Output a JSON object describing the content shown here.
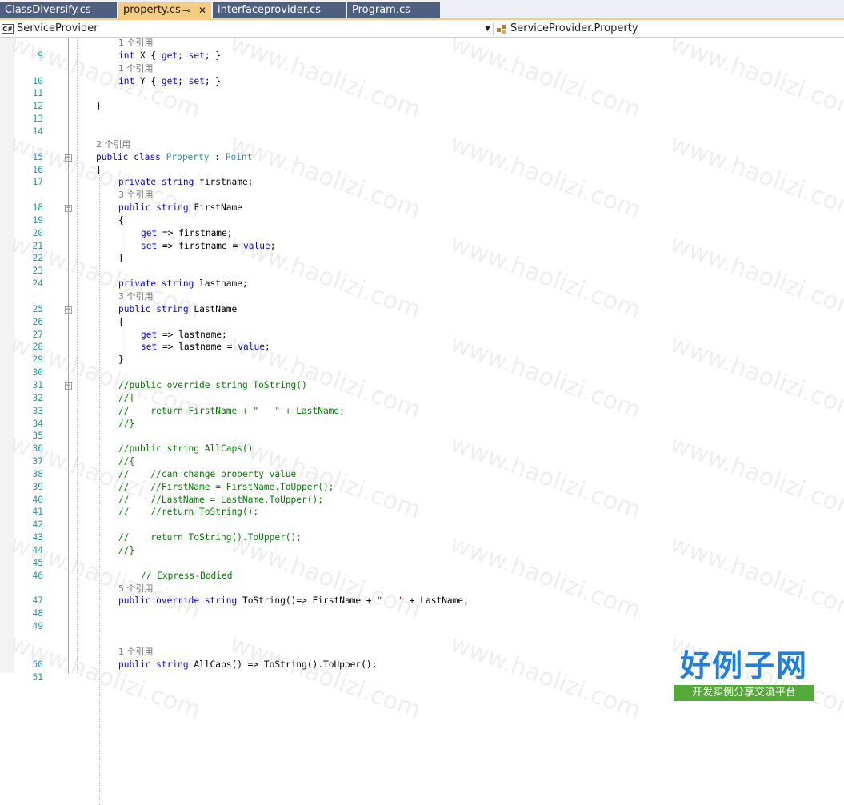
{
  "tabs": [
    {
      "label": "ClassDiversify.cs",
      "active": false
    },
    {
      "label": "property.cs",
      "active": true,
      "pin": "⊸",
      "close": "✕"
    },
    {
      "label": "interfaceprovider.cs",
      "active": false
    },
    {
      "label": "Program.cs",
      "active": false
    }
  ],
  "navbar": {
    "left_icon": "C#",
    "left_combo": "ServiceProvider",
    "right_combo": "ServiceProvider.Property"
  },
  "code": [
    {
      "n": "",
      "segs": [
        [
          "ref",
          "1 个引用"
        ]
      ],
      "ind": 4
    },
    {
      "n": "9",
      "segs": [
        [
          "kw",
          "int"
        ],
        [
          "",
          " X { "
        ],
        [
          "kw",
          "get"
        ],
        [
          "",
          "; "
        ],
        [
          "kw",
          "set"
        ],
        [
          "",
          "; }"
        ]
      ],
      "ind": 4
    },
    {
      "n": "",
      "segs": [
        [
          "ref",
          "1 个引用"
        ]
      ],
      "ind": 4
    },
    {
      "n": "10",
      "segs": [
        [
          "kw",
          "int"
        ],
        [
          "",
          " Y { "
        ],
        [
          "kw",
          "get"
        ],
        [
          "",
          "; "
        ],
        [
          "kw",
          "set"
        ],
        [
          "",
          "; }"
        ]
      ],
      "ind": 4
    },
    {
      "n": "11",
      "segs": [],
      "ind": 0
    },
    {
      "n": "12",
      "segs": [
        [
          "",
          "}"
        ]
      ],
      "ind": 2
    },
    {
      "n": "13",
      "segs": [],
      "ind": 0
    },
    {
      "n": "14",
      "segs": [],
      "ind": 0
    },
    {
      "n": "",
      "segs": [
        [
          "ref",
          "2 个引用"
        ]
      ],
      "ind": 2
    },
    {
      "n": "15",
      "segs": [
        [
          "kw",
          "public"
        ],
        [
          "",
          " "
        ],
        [
          "kw",
          "class"
        ],
        [
          "",
          " "
        ],
        [
          "ty",
          "Property"
        ],
        [
          "",
          " : "
        ],
        [
          "ty",
          "Point"
        ]
      ],
      "ind": 2,
      "fold": true
    },
    {
      "n": "16",
      "segs": [
        [
          "",
          "{"
        ]
      ],
      "ind": 2
    },
    {
      "n": "17",
      "segs": [
        [
          "kw",
          "private"
        ],
        [
          "",
          " "
        ],
        [
          "kw",
          "string"
        ],
        [
          "",
          " firstname;"
        ]
      ],
      "ind": 4
    },
    {
      "n": "",
      "segs": [
        [
          "ref",
          "3 个引用"
        ]
      ],
      "ind": 4
    },
    {
      "n": "18",
      "segs": [
        [
          "kw",
          "public"
        ],
        [
          "",
          " "
        ],
        [
          "kw",
          "string"
        ],
        [
          "",
          " FirstName"
        ]
      ],
      "ind": 4,
      "fold": true
    },
    {
      "n": "19",
      "segs": [
        [
          "",
          "{"
        ]
      ],
      "ind": 4
    },
    {
      "n": "20",
      "segs": [
        [
          "kw",
          "get"
        ],
        [
          "",
          " => firstname;"
        ]
      ],
      "ind": 6
    },
    {
      "n": "21",
      "segs": [
        [
          "kw",
          "set"
        ],
        [
          "",
          " => firstname = "
        ],
        [
          "kw",
          "value"
        ],
        [
          "",
          ";"
        ]
      ],
      "ind": 6
    },
    {
      "n": "22",
      "segs": [
        [
          "",
          "}"
        ]
      ],
      "ind": 4
    },
    {
      "n": "23",
      "segs": [],
      "ind": 0
    },
    {
      "n": "24",
      "segs": [
        [
          "kw",
          "private"
        ],
        [
          "",
          " "
        ],
        [
          "kw",
          "string"
        ],
        [
          "",
          " lastname;"
        ]
      ],
      "ind": 4
    },
    {
      "n": "",
      "segs": [
        [
          "ref",
          "3 个引用"
        ]
      ],
      "ind": 4
    },
    {
      "n": "25",
      "segs": [
        [
          "kw",
          "public"
        ],
        [
          "",
          " "
        ],
        [
          "kw",
          "string"
        ],
        [
          "",
          " LastName"
        ]
      ],
      "ind": 4,
      "fold": true
    },
    {
      "n": "26",
      "segs": [
        [
          "",
          "{"
        ]
      ],
      "ind": 4
    },
    {
      "n": "27",
      "segs": [
        [
          "kw",
          "get"
        ],
        [
          "",
          " => lastname;"
        ]
      ],
      "ind": 6
    },
    {
      "n": "28",
      "segs": [
        [
          "kw",
          "set"
        ],
        [
          "",
          " => lastname = "
        ],
        [
          "kw",
          "value"
        ],
        [
          "",
          ";"
        ]
      ],
      "ind": 6
    },
    {
      "n": "29",
      "segs": [
        [
          "",
          "}"
        ]
      ],
      "ind": 4
    },
    {
      "n": "30",
      "segs": [],
      "ind": 0
    },
    {
      "n": "31",
      "segs": [
        [
          "cm",
          "//public override string ToString()"
        ]
      ],
      "ind": 4,
      "fold": true
    },
    {
      "n": "32",
      "segs": [
        [
          "cm",
          "//{"
        ]
      ],
      "ind": 4
    },
    {
      "n": "33",
      "segs": [
        [
          "cm",
          "//    return FirstName + \"   \" + LastName;"
        ]
      ],
      "ind": 4
    },
    {
      "n": "34",
      "segs": [
        [
          "cm",
          "//}"
        ]
      ],
      "ind": 4
    },
    {
      "n": "35",
      "segs": [],
      "ind": 0
    },
    {
      "n": "36",
      "segs": [
        [
          "cm",
          "//public string AllCaps()"
        ]
      ],
      "ind": 4
    },
    {
      "n": "37",
      "segs": [
        [
          "cm",
          "//{"
        ]
      ],
      "ind": 4
    },
    {
      "n": "38",
      "segs": [
        [
          "cm",
          "//    //can change property value"
        ]
      ],
      "ind": 4
    },
    {
      "n": "39",
      "segs": [
        [
          "cm",
          "//    //FirstName = FirstName.ToUpper();"
        ]
      ],
      "ind": 4
    },
    {
      "n": "40",
      "segs": [
        [
          "cm",
          "//    //LastName = LastName.ToUpper();"
        ]
      ],
      "ind": 4
    },
    {
      "n": "41",
      "segs": [
        [
          "cm",
          "//    //return ToString();"
        ]
      ],
      "ind": 4
    },
    {
      "n": "42",
      "segs": [],
      "ind": 0
    },
    {
      "n": "43",
      "segs": [
        [
          "cm",
          "//    return ToString().ToUpper();"
        ]
      ],
      "ind": 4
    },
    {
      "n": "44",
      "segs": [
        [
          "cm",
          "//}"
        ]
      ],
      "ind": 4
    },
    {
      "n": "45",
      "segs": [],
      "ind": 0
    },
    {
      "n": "46",
      "segs": [
        [
          "cm",
          "// Express-Bodied"
        ]
      ],
      "ind": 6
    },
    {
      "n": "",
      "segs": [
        [
          "ref",
          "5 个引用"
        ]
      ],
      "ind": 4
    },
    {
      "n": "47",
      "segs": [
        [
          "kw",
          "public"
        ],
        [
          "",
          " "
        ],
        [
          "kw",
          "override"
        ],
        [
          "",
          " "
        ],
        [
          "kw",
          "string"
        ],
        [
          "",
          " ToString()=> FirstName + "
        ],
        [
          "st",
          "\"   \""
        ],
        [
          "",
          " + LastName;"
        ]
      ],
      "ind": 4
    },
    {
      "n": "48",
      "segs": [],
      "ind": 0
    },
    {
      "n": "49",
      "segs": [],
      "ind": 0
    },
    {
      "n": "",
      "segs": [],
      "ind": 0
    },
    {
      "n": "",
      "segs": [
        [
          "ref",
          "1 个引用"
        ]
      ],
      "ind": 4
    },
    {
      "n": "50",
      "segs": [
        [
          "kw",
          "public"
        ],
        [
          "",
          " "
        ],
        [
          "kw",
          "string"
        ],
        [
          "",
          " AllCaps() => ToString().ToUpper();"
        ]
      ],
      "ind": 4
    },
    {
      "n": "51",
      "segs": [],
      "ind": 0
    }
  ],
  "watermark": "www.haolizi.com",
  "logo": {
    "main": "好例子网",
    "sub": "开发实例分享交流平台"
  }
}
